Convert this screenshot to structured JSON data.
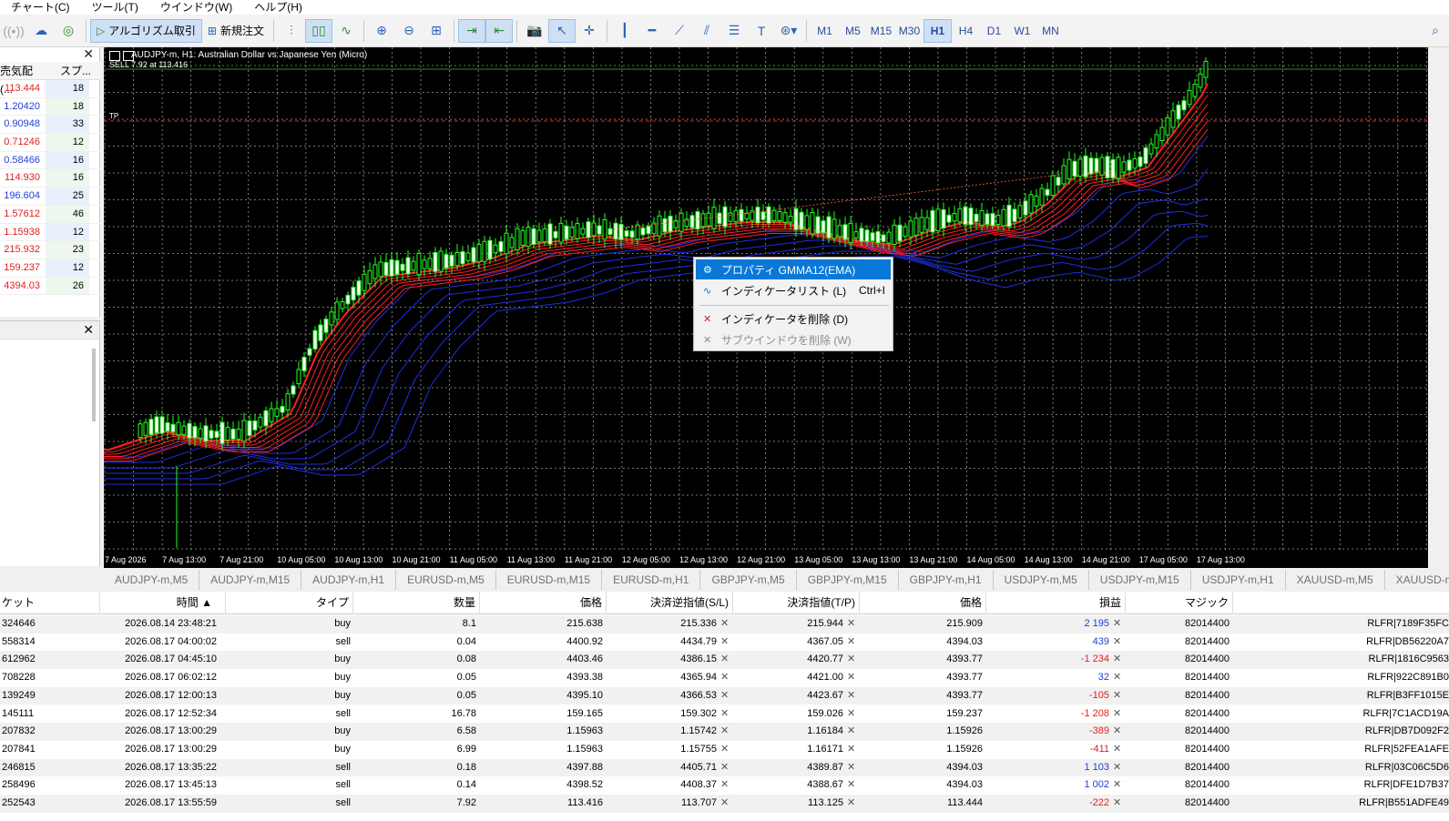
{
  "menu": [
    "チャート(C)",
    "ツール(T)",
    "ウインドウ(W)",
    "ヘルプ(H)"
  ],
  "toolbar": {
    "algo_label": "アルゴリズム取引",
    "new_order_label": "新規注文",
    "timeframes": [
      "M1",
      "M5",
      "M15",
      "M30",
      "H1",
      "H4",
      "D1",
      "W1",
      "MN"
    ],
    "selected_timeframe": "H1"
  },
  "market_watch": {
    "col_bid": "売気配(...",
    "col_spread": "スプ...",
    "rows": [
      {
        "bid": "113.444",
        "spread": "18",
        "color": "red"
      },
      {
        "bid": "1.20420",
        "spread": "18",
        "color": "blue"
      },
      {
        "bid": "0.90948",
        "spread": "33",
        "color": "blue"
      },
      {
        "bid": "0.71246",
        "spread": "12",
        "color": "red"
      },
      {
        "bid": "0.58466",
        "spread": "16",
        "color": "blue"
      },
      {
        "bid": "114.930",
        "spread": "16",
        "color": "red"
      },
      {
        "bid": "196.604",
        "spread": "25",
        "color": "blue"
      },
      {
        "bid": "1.57612",
        "spread": "46",
        "color": "red"
      },
      {
        "bid": "1.15938",
        "spread": "12",
        "color": "red"
      },
      {
        "bid": "215.932",
        "spread": "23",
        "color": "red"
      },
      {
        "bid": "159.237",
        "spread": "12",
        "color": "red"
      },
      {
        "bid": "4394.03",
        "spread": "26",
        "color": "red"
      }
    ]
  },
  "chart": {
    "title": "AUDJPY-m, H1:  Australian Dollar vs Japanese Yen (Micro)",
    "sell_label": "SELL 7.92 at 113.416",
    "tp_label": "TP",
    "x_labels": [
      "7 Aug 2026",
      "7 Aug 13:00",
      "7 Aug 21:00",
      "10 Aug 05:00",
      "10 Aug 13:00",
      "10 Aug 21:00",
      "11 Aug 05:00",
      "11 Aug 13:00",
      "11 Aug 21:00",
      "12 Aug 05:00",
      "12 Aug 13:00",
      "12 Aug 21:00",
      "13 Aug 05:00",
      "13 Aug 13:00",
      "13 Aug 21:00",
      "14 Aug 05:00",
      "14 Aug 13:00",
      "14 Aug 21:00",
      "17 Aug 05:00",
      "17 Aug 13:00"
    ]
  },
  "context_menu": {
    "items": [
      {
        "label": "プロパティ GMMA12(EMA)",
        "shortcut": "",
        "state": "highlighted",
        "icon": "gear-icon"
      },
      {
        "label": "インディケータリスト (L)",
        "shortcut": "Ctrl+I",
        "state": "normal",
        "icon": "indicator-list-icon"
      },
      {
        "label": "インディケータを削除 (D)",
        "shortcut": "",
        "state": "normal",
        "icon": "delete-x-icon"
      },
      {
        "label": "サブウインドウを削除 (W)",
        "shortcut": "",
        "state": "disabled",
        "icon": "delete-x-icon"
      }
    ]
  },
  "chart_tabs": [
    "AUDJPY-m,M5",
    "AUDJPY-m,M15",
    "AUDJPY-m,H1",
    "EURUSD-m,M5",
    "EURUSD-m,M15",
    "EURUSD-m,H1",
    "GBPJPY-m,M5",
    "GBPJPY-m,M15",
    "GBPJPY-m,H1",
    "USDJPY-m,M5",
    "USDJPY-m,M15",
    "USDJPY-m,H1",
    "XAUUSD-m,M5",
    "XAUUSD-m,M15",
    "XAUUS"
  ],
  "trade_table": {
    "headers": [
      "ケット",
      "時間",
      "タイプ",
      "数量",
      "価格",
      "決済逆指値(S/L)",
      "決済指値(T/P)",
      "価格",
      "損益",
      "マジック"
    ],
    "rows": [
      {
        "ticket": "324646",
        "time": "2026.08.14 23:48:21",
        "type": "buy",
        "volume": "8.1",
        "price": "215.638",
        "sl": "215.336",
        "tp": "215.944",
        "cur": "215.909",
        "profit": "2 195",
        "profit_color": "blue",
        "magic": "82014400",
        "comment": "RLFR|7189F35FC"
      },
      {
        "ticket": "558314",
        "time": "2026.08.17 04:00:02",
        "type": "sell",
        "volume": "0.04",
        "price": "4400.92",
        "sl": "4434.79",
        "tp": "4367.05",
        "cur": "4394.03",
        "profit": "439",
        "profit_color": "blue",
        "magic": "82014400",
        "comment": "RLFR|DB56220A7"
      },
      {
        "ticket": "612962",
        "time": "2026.08.17 04:45:10",
        "type": "buy",
        "volume": "0.08",
        "price": "4403.46",
        "sl": "4386.15",
        "tp": "4420.77",
        "cur": "4393.77",
        "profit": "-1 234",
        "profit_color": "red",
        "magic": "82014400",
        "comment": "RLFR|1816C9563"
      },
      {
        "ticket": "708228",
        "time": "2026.08.17 06:02:12",
        "type": "buy",
        "volume": "0.05",
        "price": "4393.38",
        "sl": "4365.94",
        "tp": "4421.00",
        "cur": "4393.77",
        "profit": "32",
        "profit_color": "blue",
        "magic": "82014400",
        "comment": "RLFR|922C891B0"
      },
      {
        "ticket": "139249",
        "time": "2026.08.17 12:00:13",
        "type": "buy",
        "volume": "0.05",
        "price": "4395.10",
        "sl": "4366.53",
        "tp": "4423.67",
        "cur": "4393.77",
        "profit": "-105",
        "profit_color": "red",
        "magic": "82014400",
        "comment": "RLFR|B3FF1015E"
      },
      {
        "ticket": "145111",
        "time": "2026.08.17 12:52:34",
        "type": "sell",
        "volume": "16.78",
        "price": "159.165",
        "sl": "159.302",
        "tp": "159.026",
        "cur": "159.237",
        "profit": "-1 208",
        "profit_color": "red",
        "magic": "82014400",
        "comment": "RLFR|7C1ACD19A"
      },
      {
        "ticket": "207832",
        "time": "2026.08.17 13:00:29",
        "type": "buy",
        "volume": "6.58",
        "price": "1.15963",
        "sl": "1.15742",
        "tp": "1.16184",
        "cur": "1.15926",
        "profit": "-389",
        "profit_color": "red",
        "magic": "82014400",
        "comment": "RLFR|DB7D092F2"
      },
      {
        "ticket": "207841",
        "time": "2026.08.17 13:00:29",
        "type": "buy",
        "volume": "6.99",
        "price": "1.15963",
        "sl": "1.15755",
        "tp": "1.16171",
        "cur": "1.15926",
        "profit": "-411",
        "profit_color": "red",
        "magic": "82014400",
        "comment": "RLFR|52FEA1AFE"
      },
      {
        "ticket": "246815",
        "time": "2026.08.17 13:35:22",
        "type": "sell",
        "volume": "0.18",
        "price": "4397.88",
        "sl": "4405.71",
        "tp": "4389.87",
        "cur": "4394.03",
        "profit": "1 103",
        "profit_color": "blue",
        "magic": "82014400",
        "comment": "RLFR|03C06C5D6"
      },
      {
        "ticket": "258496",
        "time": "2026.08.17 13:45:13",
        "type": "sell",
        "volume": "0.14",
        "price": "4398.52",
        "sl": "4408.37",
        "tp": "4388.67",
        "cur": "4394.03",
        "profit": "1 002",
        "profit_color": "blue",
        "magic": "82014400",
        "comment": "RLFR|DFE1D7B37"
      },
      {
        "ticket": "252543",
        "time": "2026.08.17 13:55:59",
        "type": "sell",
        "volume": "7.92",
        "price": "113.416",
        "sl": "113.707",
        "tp": "113.125",
        "cur": "113.444",
        "profit": "-222",
        "profit_color": "red",
        "magic": "82014400",
        "comment": "RLFR|B551ADFE49"
      }
    ]
  },
  "colors": {
    "bull": "#22ff22",
    "short_ema": "#ff2020",
    "long_ema": "#2030ff",
    "highlight": "#0a78d7"
  }
}
